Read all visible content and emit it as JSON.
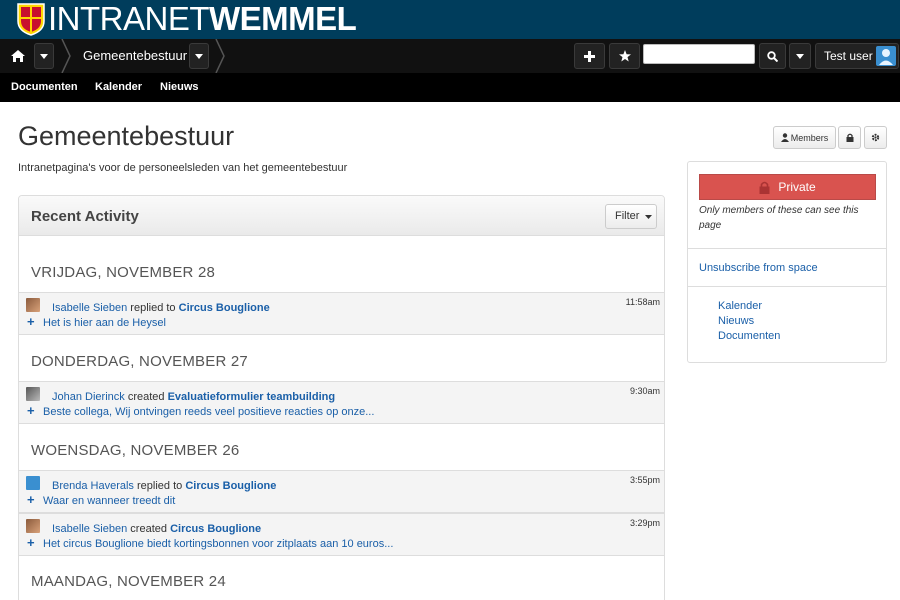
{
  "banner": {
    "brand_light": "INTRANET",
    "brand_bold": "WEMMEL"
  },
  "navbar": {
    "breadcrumb": "Gemeentebestuur",
    "search": {
      "value": "",
      "placeholder": ""
    },
    "user_name": "Test user"
  },
  "subnav": {
    "items": [
      "Documenten",
      "Kalender",
      "Nieuws"
    ]
  },
  "page": {
    "title": "Gemeentebestuur",
    "description": "Intranetpagina's voor de personeelsleden van het gemeentebestuur",
    "members_label": "Members"
  },
  "activity": {
    "title": "Recent Activity",
    "filter_label": "Filter",
    "days": [
      {
        "label": "VRIJDAG, NOVEMBER 28"
      },
      {
        "label": "DONDERDAG, NOVEMBER 27"
      },
      {
        "label": "WOENSDAG, NOVEMBER 26"
      },
      {
        "label": "MAANDAG, NOVEMBER 24"
      }
    ],
    "items": [
      {
        "user": "Isabelle Sieben",
        "action": "replied to",
        "object": "Circus Bouglione",
        "snippet": "Het is hier aan de Heysel",
        "time": "11:58am"
      },
      {
        "user": "Johan Dierinck",
        "action": "created",
        "object": "Evaluatieformulier teambuilding",
        "snippet": "Beste collega,   Wij ontvingen reeds veel positieve reacties op onze...",
        "time": "9:30am"
      },
      {
        "user": "Brenda Haverals",
        "action": "replied to",
        "object": "Circus Bouglione",
        "snippet": "Waar en wanneer treedt dit",
        "time": "3:55pm"
      },
      {
        "user": "Isabelle Sieben",
        "action": "created",
        "object": "Circus Bouglione",
        "snippet": "Het circus Bouglione biedt kortingsbonnen voor zitplaats aan 10 euros...",
        "time": "3:29pm"
      }
    ]
  },
  "sidebar": {
    "private_label": "Private",
    "private_note": "Only members of these can see this page",
    "unsubscribe": "Unsubscribe from space",
    "links": [
      "Kalender",
      "Nieuws",
      "Documenten"
    ]
  },
  "colors": {
    "banner": "#003d5c",
    "navbar": "#111111",
    "link": "#1a5fa8",
    "private": "#d9534f"
  }
}
